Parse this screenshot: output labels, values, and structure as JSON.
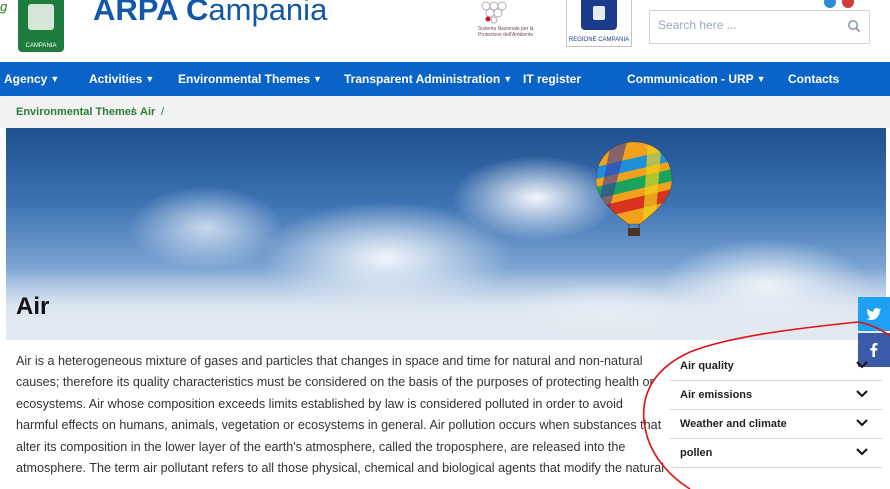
{
  "corner_label": "g",
  "header": {
    "brand_bold": "ARPA C",
    "brand_rest": "ampania",
    "logo_text": "CAMPANIA",
    "partner_text": "Sistema Nazionale per la Protezione dell'Ambiente",
    "regione_text": "REGIONE CAMPANIA",
    "search_placeholder": "Search here ..."
  },
  "nav": {
    "items": [
      {
        "label": "Agency",
        "has_dropdown": true
      },
      {
        "label": "Activities",
        "has_dropdown": true
      },
      {
        "label": "Environmental Themes",
        "has_dropdown": true
      },
      {
        "label": "Transparent Administration",
        "has_dropdown": true
      },
      {
        "label": "IT register",
        "has_dropdown": false
      },
      {
        "label": "Communication - URP",
        "has_dropdown": true
      },
      {
        "label": "Contacts",
        "has_dropdown": false
      }
    ]
  },
  "breadcrumb": {
    "items": [
      "Environmental Themes",
      "Air"
    ],
    "separator": "/"
  },
  "page": {
    "title": "Air",
    "body": "Air is a heterogeneous mixture of gases and particles that changes in space and time for natural and non-natural causes; therefore its quality characteristics must be considered on the basis of the purposes of protecting health or ecosystems. Air whose composition exceeds limits established by law is considered polluted in order to avoid harmful effects on humans, animals, vegetation or ecosystems in general. Air pollution occurs when substances that alter its composition in the lower layer of the earth's atmosphere, called the troposphere, are released into the atmosphere. The term air pollutant refers to all those physical, chemical and biological agents that modify the natural"
  },
  "side_menu": {
    "items": [
      "Air quality",
      "Air emissions",
      "Weather and climate",
      "pollen"
    ]
  },
  "colors": {
    "nav_blue": "#0a63c9",
    "brand_blue": "#1258a8",
    "breadcrumb_green": "#2d7d3a",
    "annotation_red": "#e01010",
    "twitter": "#1ea1f2",
    "facebook": "#3b5ba8"
  },
  "icons": {
    "search": "search-icon",
    "twitter": "twitter-icon",
    "facebook": "facebook-icon",
    "chevron": "chevron-down-icon"
  }
}
